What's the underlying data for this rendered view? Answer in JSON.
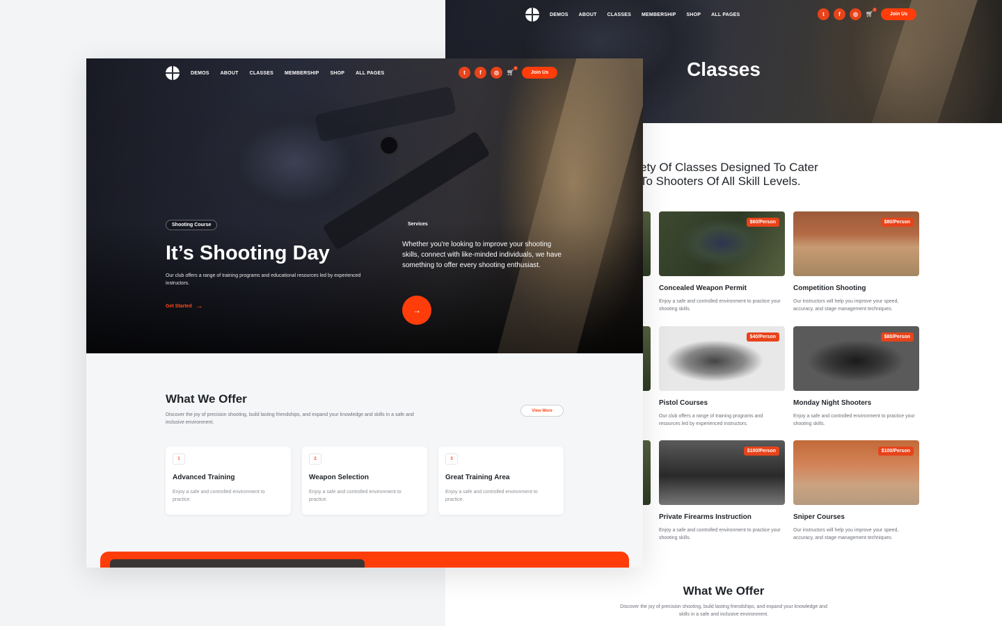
{
  "classes_page": {
    "nav": {
      "links": [
        "DEMOS",
        "ABOUT",
        "CLASSES",
        "MEMBERSHIP",
        "SHOP",
        "ALL PAGES"
      ],
      "cart_count": "1",
      "join_label": "Join Us"
    },
    "hero_title": "Classes",
    "heading_line1": "ety Of Classes Designed To Cater",
    "heading_line2": "To Shooters Of All Skill Levels.",
    "cards": [
      {
        "name": "Concealed Weapon Permit",
        "price": "$60/Person",
        "desc": "Enjoy a safe and controlled environment to practice your shooting skills."
      },
      {
        "name": "Competition Shooting",
        "price": "$80/Person",
        "desc": "Our instructors will help you improve your speed, accuracy, and stage management techniques."
      },
      {
        "name": "Pistol Courses",
        "price": "$40/Person",
        "desc": "Our club offers a range of training programs and resources led by experienced instructors."
      },
      {
        "name": "Monday Night Shooters",
        "price": "$80/Person",
        "desc": "Enjoy a safe and controlled environment to practice your shooting skills."
      },
      {
        "name": "Private Firearms Instruction",
        "price": "$100/Person",
        "desc": "Enjoy a safe and controlled environment to practice your shooting skills."
      },
      {
        "name": "Sniper Courses",
        "price": "$100/Person",
        "desc": "Our instructors will help you improve your speed, accuracy, and stage management techniques."
      }
    ],
    "offer_title": "What We Offer",
    "offer_desc": "Discover the joy of precision shooting, build lasting friendships, and expand your knowledge and skills in a safe and inclusive environment."
  },
  "home_page": {
    "nav": {
      "links": [
        "DEMOS",
        "ABOUT",
        "CLASSES",
        "MEMBERSHIP",
        "SHOP",
        "ALL PAGES"
      ],
      "cart_count": "1",
      "join_label": "Join Us"
    },
    "hero": {
      "badge": "Shooting Course",
      "title": "It’s Shooting Day",
      "desc": "Our club offers a range of training programs and educational resources led by experienced instructors.",
      "cta": "Get Started",
      "services_badge": "Services",
      "services_text": "Whether you're looking to improve your shooting skills, connect with like-minded individuals, we have something to offer every shooting enthusiast."
    },
    "offer": {
      "title": "What We Offer",
      "desc": "Discover the joy of precision shooting, build lasting friendships, and expand your knowledge and skills in a safe and inclusive environment.",
      "view_more": "View More",
      "cards": [
        {
          "num": "1",
          "name": "Advanced Training",
          "desc": "Enjoy a safe and controlled environment to practice."
        },
        {
          "num": "2",
          "name": "Weapon Selection",
          "desc": "Enjoy a safe and controlled environment to practice."
        },
        {
          "num": "3",
          "name": "Great Training Area",
          "desc": "Enjoy a safe and controlled environment to practice."
        }
      ]
    }
  },
  "icons": {
    "social": [
      "twitter-icon",
      "facebook-icon",
      "instagram-icon"
    ],
    "cart": "cart-icon",
    "logo": "logo-icon",
    "arrow": "arrow-right-icon"
  },
  "colors": {
    "accent": "#ff3d0a",
    "price_badge": "#e8431a",
    "text_dark": "#1f2328",
    "text_muted": "#6b6f76"
  }
}
